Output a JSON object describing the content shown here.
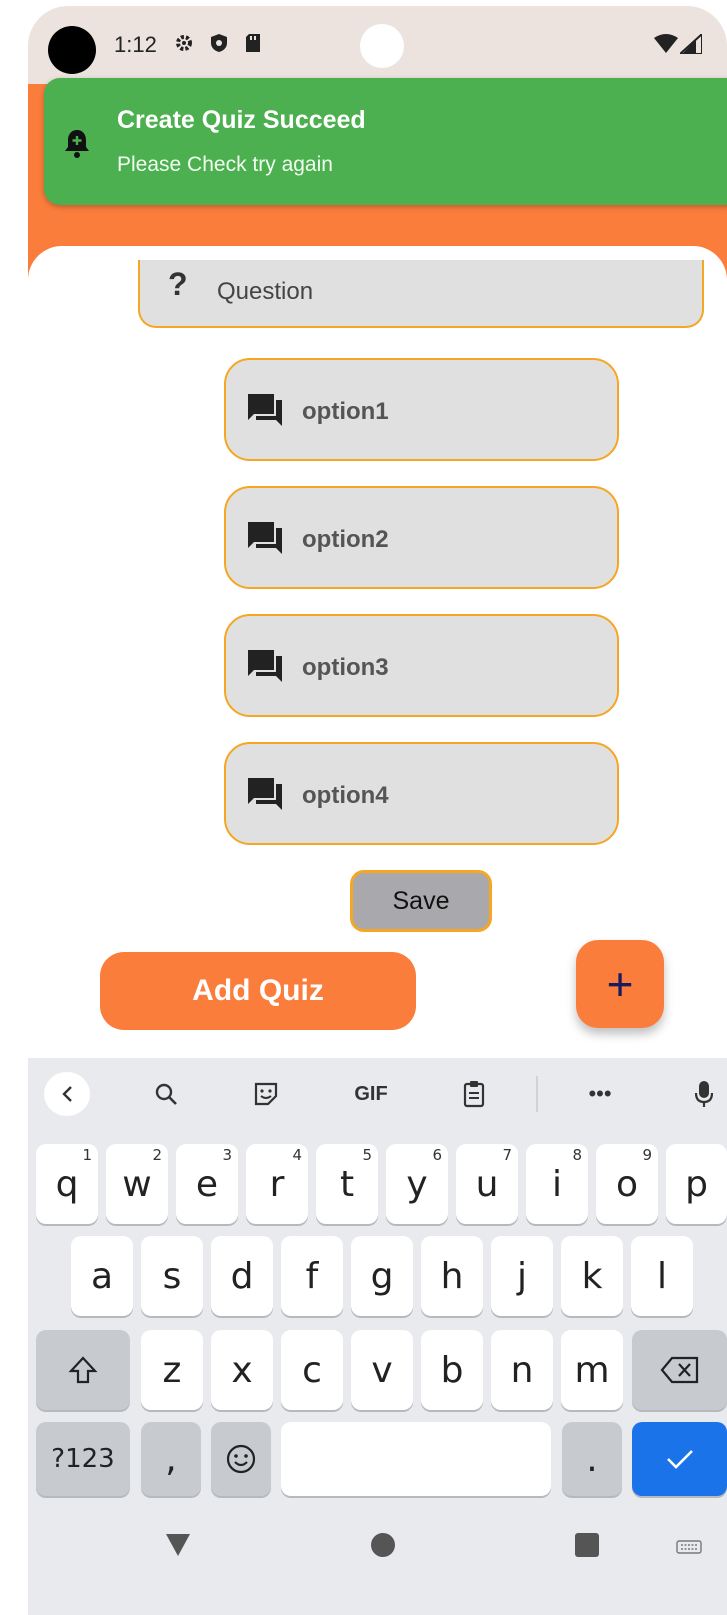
{
  "status_bar": {
    "time": "1:12"
  },
  "snackbar": {
    "title": "Create Quiz Succeed",
    "message": "Please Check try again"
  },
  "form": {
    "question_placeholder": "Question",
    "options": [
      "option1",
      "option2",
      "option3",
      "option4"
    ],
    "save_label": "Save",
    "add_quiz_label": "Add Quiz",
    "fab_label": "+"
  },
  "keyboard": {
    "toolbar": {
      "gif": "GIF",
      "more": "•••"
    },
    "row1": [
      {
        "k": "q",
        "h": "1"
      },
      {
        "k": "w",
        "h": "2"
      },
      {
        "k": "e",
        "h": "3"
      },
      {
        "k": "r",
        "h": "4"
      },
      {
        "k": "t",
        "h": "5"
      },
      {
        "k": "y",
        "h": "6"
      },
      {
        "k": "u",
        "h": "7"
      },
      {
        "k": "i",
        "h": "8"
      },
      {
        "k": "o",
        "h": "9"
      },
      {
        "k": "p",
        "h": ""
      }
    ],
    "row2": [
      "a",
      "s",
      "d",
      "f",
      "g",
      "h",
      "j",
      "k",
      "l"
    ],
    "row3": [
      "z",
      "x",
      "c",
      "v",
      "b",
      "n",
      "m"
    ],
    "symbols": "?123",
    "comma": ",",
    "period": "."
  },
  "colors": {
    "accent_orange": "#fb7d3c",
    "success_green": "#4caf50",
    "field_border": "#f5a623",
    "keyboard_enter": "#1a73e8"
  }
}
